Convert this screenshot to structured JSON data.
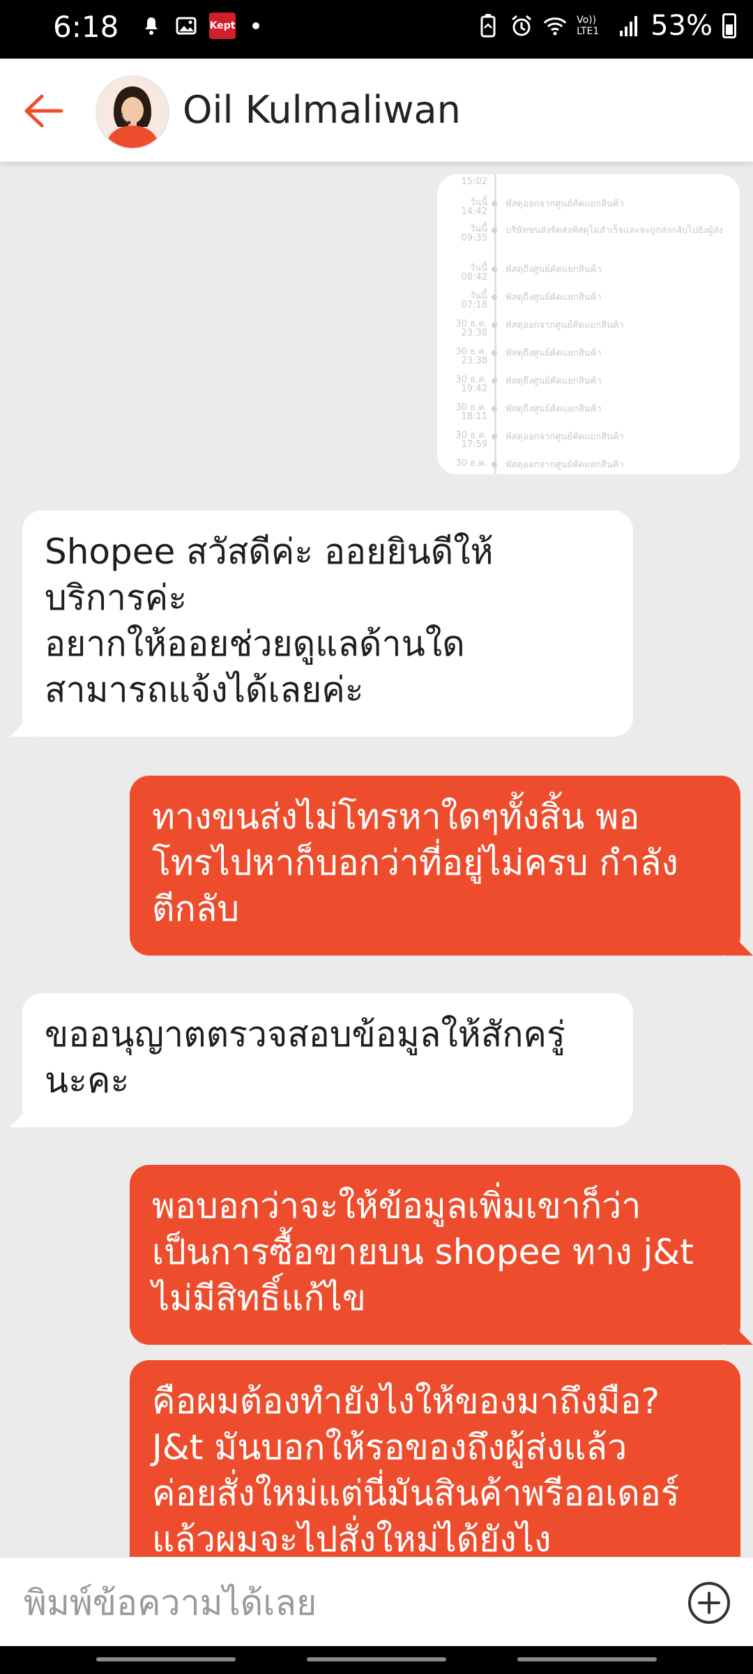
{
  "status_bar": {
    "time": "6:18",
    "left_icons": [
      "notification-icon",
      "gallery-icon",
      "kept-app-icon",
      "dot-icon"
    ],
    "kept_label": "Kept",
    "right_icons": [
      "battery-saver-icon",
      "alarm-icon",
      "wifi-icon",
      "volte-icon",
      "signal-icon"
    ],
    "volte_label": "Vo)) LTE1",
    "battery_percent": "53%"
  },
  "header": {
    "back_icon": "arrow-left-icon",
    "contact_name": "Oil Kulmaliwan",
    "accent_color": "#ee4d2d"
  },
  "tracking_image": {
    "rows": [
      {
        "date": "15:02",
        "text": ""
      },
      {
        "date": "วันนี้ 14:42",
        "text": "พัสดุออกจากศูนย์คัดแยกสินค้า"
      },
      {
        "date": "วันนี้ 09:35",
        "text": "บริษัทขนส่งจัดส่งพัสดุไม่สำเร็จและจะถูกส่งกลับไปยังผู้ส่ง"
      },
      {
        "date": "วันนี้ 08:42",
        "text": "พัสดุถึงศูนย์คัดแยกสินค้า"
      },
      {
        "date": "วันนี้ 07:18",
        "text": "พัสดุถึงศูนย์คัดแยกสินค้า"
      },
      {
        "date": "30 ธ.ค. 23:38",
        "text": "พัสดุออกจากศูนย์คัดแยกสินค้า"
      },
      {
        "date": "30 ธ.ค. 23:38",
        "text": "พัสดุถึงศูนย์คัดแยกสินค้า"
      },
      {
        "date": "30 ธ.ค. 19:42",
        "text": "พัสดุถึงศูนย์คัดแยกสินค้า"
      },
      {
        "date": "30 ธ.ค. 18:11",
        "text": "พัสดุถึงศูนย์คัดแยกสินค้า"
      },
      {
        "date": "30 ธ.ค. 17:59",
        "text": "พัสดุออกจากศูนย์คัดแยกสินค้า"
      },
      {
        "date": "30 ธ.ค.",
        "text": "พัสดุออกจากศูนย์คัดแยกสินค้า"
      }
    ]
  },
  "messages": [
    {
      "from": "agent",
      "text": "Shopee สวัสดีค่ะ ออยยินดีให้\nบริการค่ะ\nอยากให้ออยช่วยดูแลด้านใด\nสามารถแจ้งได้เลยค่ะ"
    },
    {
      "from": "user",
      "text": "ทางขนส่งไม่โทรหาใดๆทั้งสิ้น พอ\nโทรไปหาก็บอกว่าที่อยู่ไม่ครบ กำลัง\nตีกลับ"
    },
    {
      "from": "agent",
      "text": "ขออนุญาตตรวจสอบข้อมูลให้สักครู่\nนะคะ"
    },
    {
      "from": "user",
      "text": "พอบอกว่าจะให้ข้อมูลเพิ่มเขาก็ว่า\nเป็นการซื้อขายบน shopee ทาง j&t\nไม่มีสิทธิ์แก้ไข"
    },
    {
      "from": "user",
      "text": "คือผมต้องทำยังไงให้ของมาถึงมือ?\nJ&t มันบอกให้รอของถึงผู้ส่งแล้ว\nค่อยสั่งใหม่แต่นี่มันสินค้าพรีออเดอร์\nแล้วผมจะไปสั่งใหม่ได้ยังไง"
    }
  ],
  "composer": {
    "placeholder": "พิมพ์ข้อความได้เลย",
    "value": "",
    "add_icon": "plus-circle-icon"
  }
}
